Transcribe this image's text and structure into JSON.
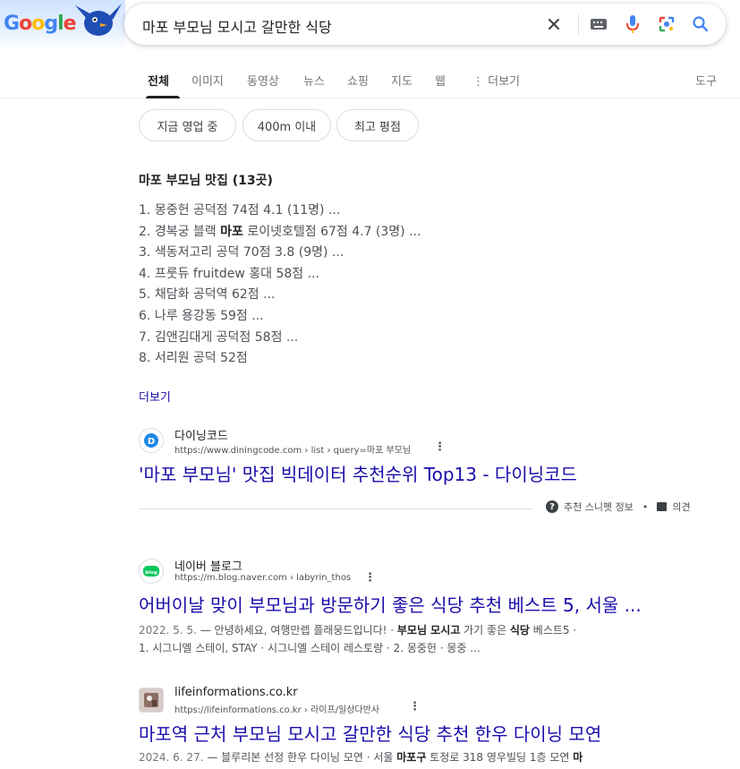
{
  "search": {
    "logo_text": "Google",
    "query": "마포 부모님 모시고 갈만한 식당"
  },
  "tabs": [
    {
      "label": "전체"
    },
    {
      "label": "이미지"
    },
    {
      "label": "동영상"
    },
    {
      "label": "뉴스"
    },
    {
      "label": "쇼핑"
    },
    {
      "label": "지도"
    },
    {
      "label": "웹"
    },
    {
      "label": "⋮ 더보기"
    }
  ],
  "tools_label": "도구",
  "chips": [
    {
      "label": "지금 영업 중"
    },
    {
      "label": "400m 이내"
    },
    {
      "label": "최고 평점"
    }
  ],
  "snippet": {
    "title": "마포 부모님 맛집 (13곳)",
    "items": [
      {
        "num": "1.",
        "text": "몽중헌 공덕점 74점 4.1 (11명) ..."
      },
      {
        "num": "2.",
        "pre": "경복궁 블랙 ",
        "bold": "마포",
        "post": " 로이넷호텔점 67점 4.7 (3명) ..."
      },
      {
        "num": "3.",
        "text": "색동저고리 공덕 70점 3.8 (9명) ..."
      },
      {
        "num": "4.",
        "text": "프룻듀 fruitdew 홍대 58점 ..."
      },
      {
        "num": "5.",
        "text": "채담화 공덕역 62점 ..."
      },
      {
        "num": "6.",
        "text": "나루 용강동 59점 ..."
      },
      {
        "num": "7.",
        "text": "김앤김대게 공덕점 58점 ..."
      },
      {
        "num": "8.",
        "text": "서리원 공덕 52점"
      }
    ],
    "more": "더보기"
  },
  "results": [
    {
      "site": "다이닝코드",
      "url": "https://www.diningcode.com › list › query=마포 부모님",
      "title": "'마포 부모님' 맛집 빅데이터 추천순위 Top13 - 다이닝코드",
      "favicon_color": "#1e88e5"
    },
    {
      "site": "네이버 블로그",
      "url": "https://m.blog.naver.com › labyrin_thos",
      "title": "어버이날 맞이 부모님과 방문하기 좋은 식당 추천 베스트 5, 서울 ...",
      "date": "2022. 5. 5.",
      "desc1_a": " — 안녕하세요, 여행만렙 플래뭉드입니다! · ",
      "desc1_b": "부모님 모시고",
      "desc1_c": " 가기 좋은 ",
      "desc1_d": "식당",
      "desc1_e": " 베스트5 ·",
      "desc2": "1. 시그니엘 스테이, STAY · 시그니엘 스테이 레스토랑 · 2. 몽중헌 · 몽중 ...",
      "favicon_color": "#03c75a"
    },
    {
      "site": "lifeinformations.co.kr",
      "url": "https://lifeinformations.co.kr › 라이프/일상다반사",
      "title": "마포역 근처 부모님 모시고 갈만한 식당 추천 한우 다이닝 모연",
      "date": "2024. 6. 27.",
      "desc1_a": " — 블루리본 선정 한우 다이닝 모연 · 서울 ",
      "desc1_b": "마포구",
      "desc1_c": " 토정로 318 영우빌딩 1층 모연 ",
      "desc1_d": "마",
      "favicon_color": "#8d6e63"
    }
  ],
  "feedback": {
    "snippet_info": "추천 스니펫 정보",
    "dot": "•",
    "opinion": "의견"
  },
  "colors": {
    "link": "#1a0dab",
    "text": "#202124",
    "muted": "#4d5156"
  }
}
